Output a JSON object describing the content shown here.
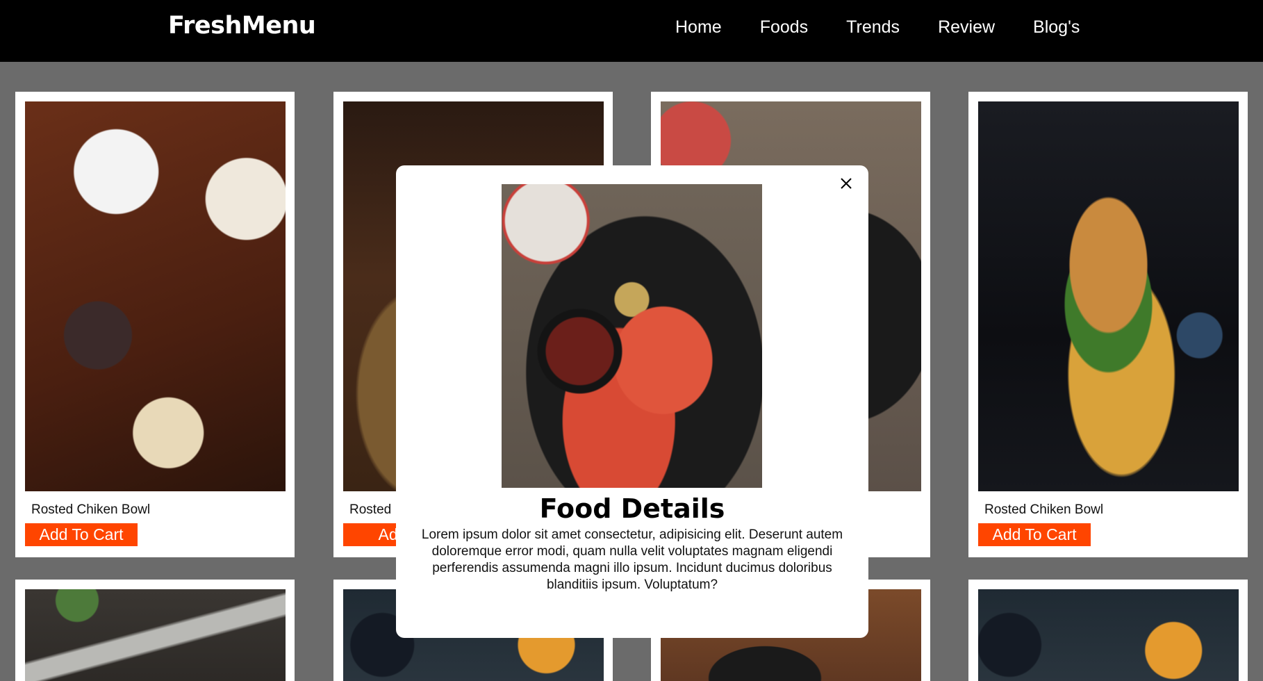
{
  "brand": "FreshMenu",
  "nav": {
    "items": [
      "Home",
      "Foods",
      "Trends",
      "Review",
      "Blog's"
    ]
  },
  "cards": [
    {
      "name": "Rosted Chiken Bowl",
      "button": "Add To Cart",
      "image": "food-table-spread"
    },
    {
      "name": "Rosted",
      "button": "Add T",
      "image": "food-bread-board"
    },
    {
      "name": "",
      "button": "",
      "image": "grilled-shrimp-plate"
    },
    {
      "name": "Rosted Chiken Bowl",
      "button": "Add To Cart",
      "image": "burger-with-fries"
    }
  ],
  "modal": {
    "title": "Food Details",
    "text": "Lorem ipsum dolor sit amet consectetur, adipisicing elit. Deserunt autem doloremque error modi, quam nulla velit voluptates magnam eligendi perferendis assumenda magni illo ipsum. Incidunt ducimus doloribus blanditiis ipsum. Voluptatum?",
    "image": "grilled-shrimp-plate",
    "close_icon": "close-icon"
  },
  "colors": {
    "nav_bg": "#000000",
    "page_bg": "#6b6b6b",
    "accent": "#ff4500"
  }
}
